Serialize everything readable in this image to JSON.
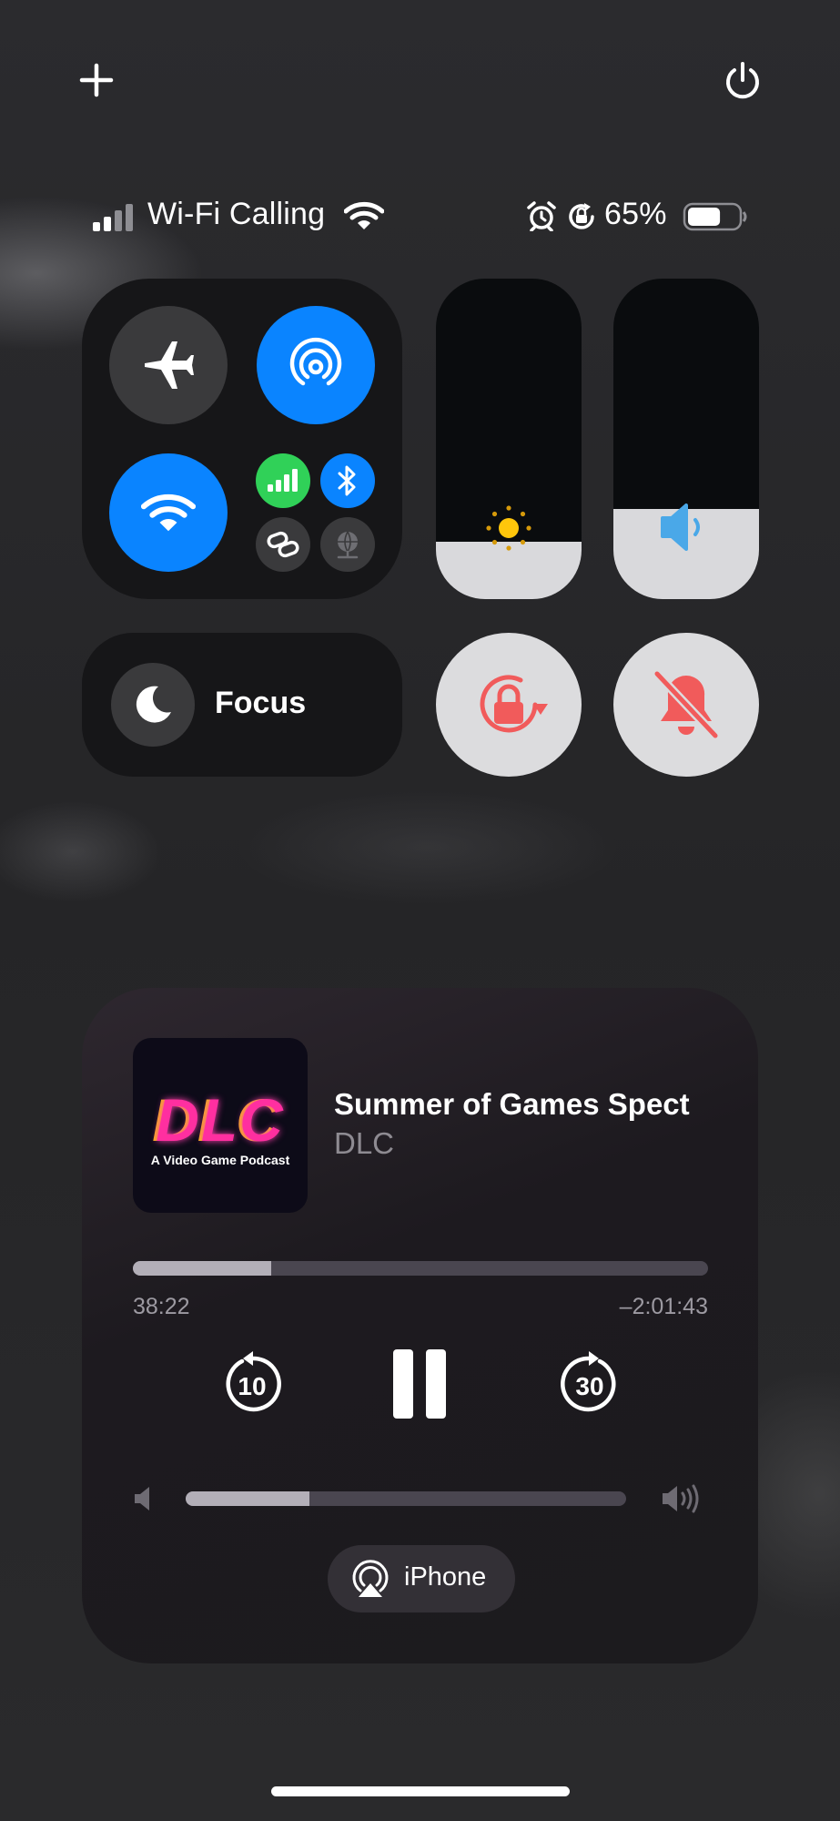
{
  "top_controls": {
    "add_icon": "plus-icon",
    "power_icon": "power-icon"
  },
  "status_bar": {
    "carrier": "Wi-Fi Calling",
    "battery_percent": "65%",
    "battery_level": 0.65,
    "icons": [
      "cellular-signal-icon",
      "wifi-icon",
      "alarm-icon",
      "rotation-lock-icon",
      "battery-icon"
    ]
  },
  "connectivity": {
    "airplane_mode": false,
    "airdrop": true,
    "wifi": true,
    "cellular": true,
    "bluetooth": true,
    "personal_hotspot": false,
    "vpn": false
  },
  "sliders": {
    "brightness_level": 0.18,
    "volume_level": 0.28
  },
  "focus": {
    "label": "Focus"
  },
  "toggles": {
    "orientation_lock": true,
    "silent_mode": true
  },
  "colors": {
    "accent_blue": "#0a84ff",
    "green": "#30d158",
    "alert_red": "#f15b5b",
    "sun_yellow": "#ffc60b"
  },
  "now_playing": {
    "artwork_title": "DLC",
    "artwork_subtitle": "A Video Game Podcast",
    "title": "Summer of Games Spect",
    "artist": "DLC",
    "elapsed": "38:22",
    "remaining": "–2:01:43",
    "progress": 0.24,
    "skip_back_seconds": "10",
    "skip_forward_seconds": "30",
    "volume": 0.28,
    "output_device": "iPhone"
  }
}
